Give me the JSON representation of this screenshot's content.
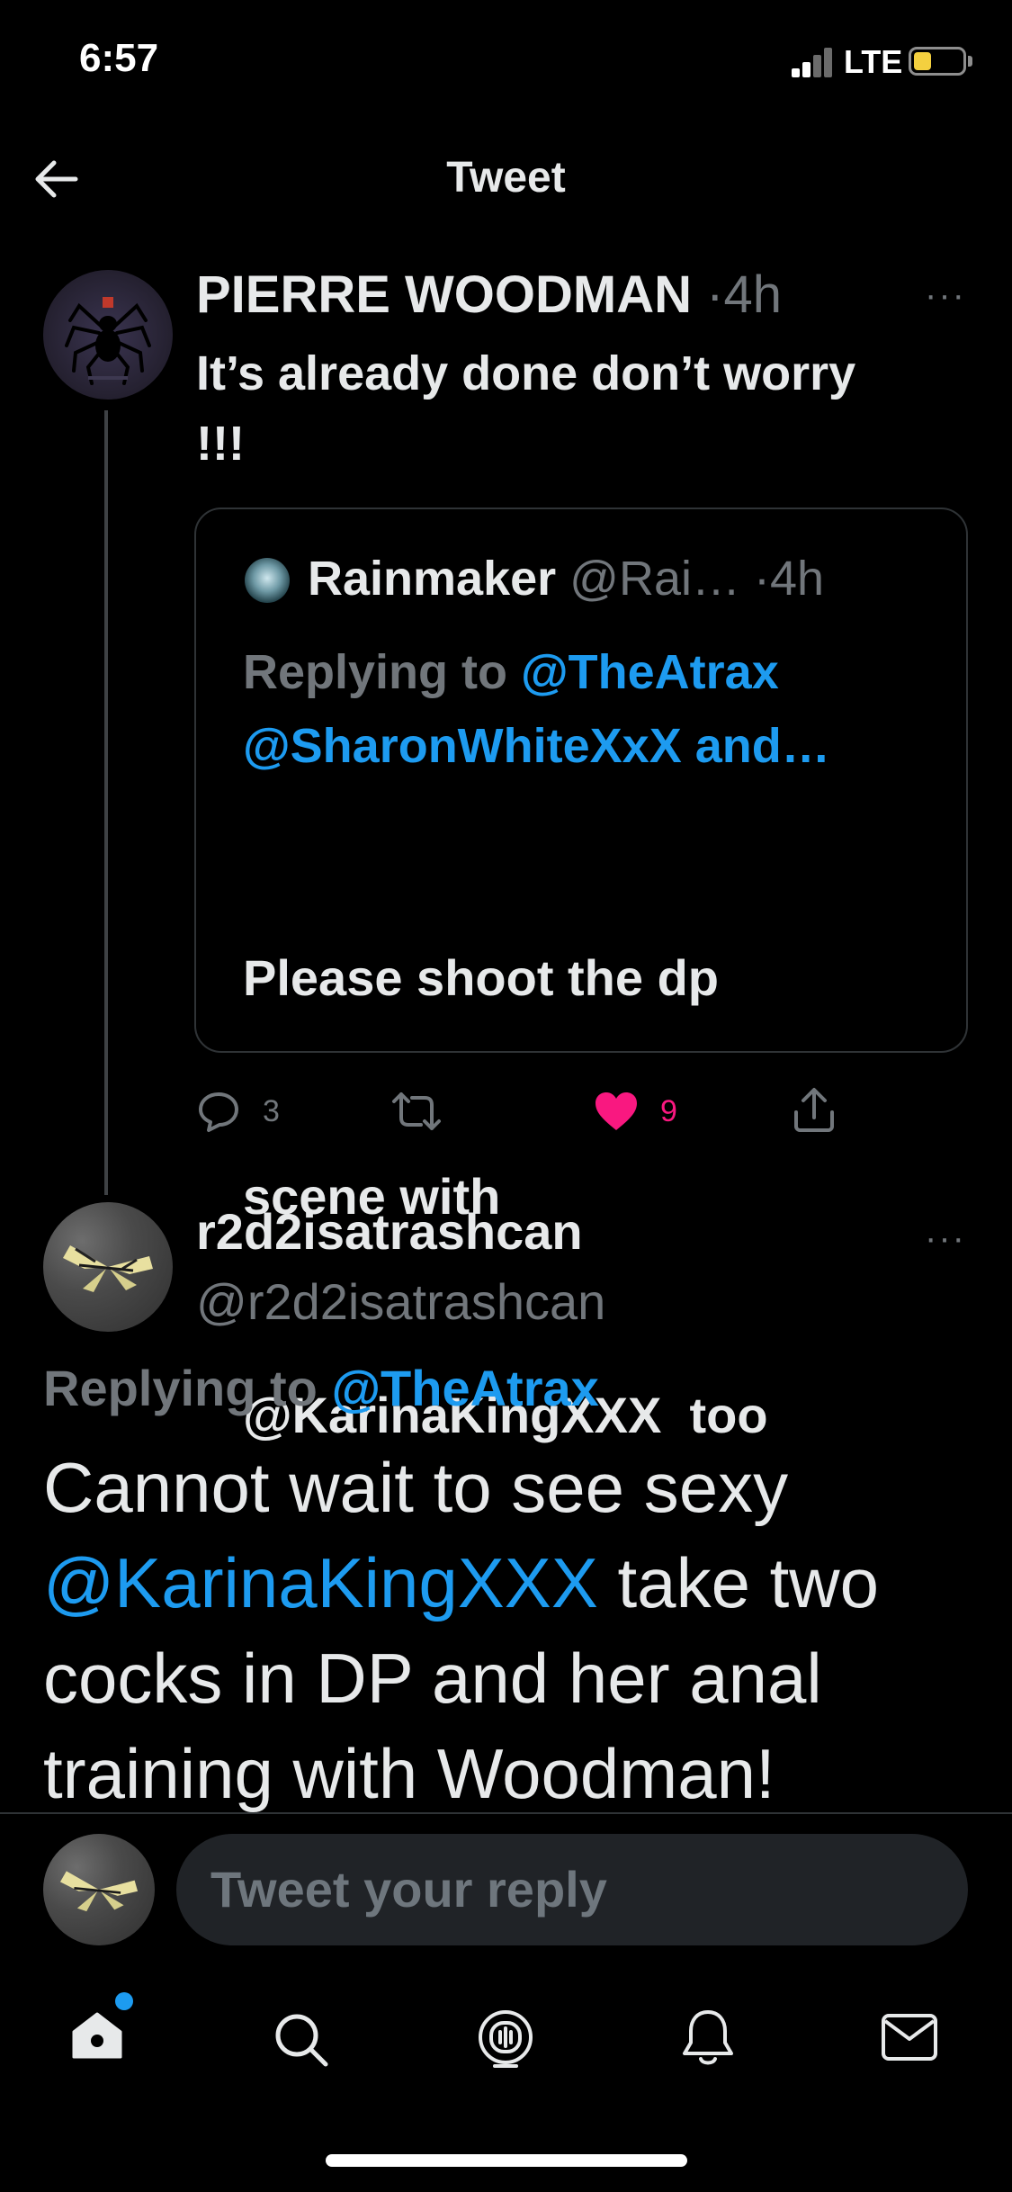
{
  "status_bar": {
    "time": "6:57",
    "network": "LTE",
    "battery_level": 0.35
  },
  "header": {
    "title": "Tweet",
    "back_icon": "arrow-left-icon"
  },
  "main_tweet": {
    "name": "PIERRE WOODMAN",
    "separator": "·",
    "time": "4h",
    "more": "···",
    "text_line1": "It’s already done don’t worry",
    "text_line2": "!!!",
    "quote": {
      "name": "Rainmaker",
      "handle": "@Rai…",
      "separator": "·",
      "time": "4h",
      "replying_label": "Replying to",
      "replying_to_1": "@TheAtrax",
      "replying_to_2": "@SharonWhiteXxX and…",
      "text_line1": "Please shoot the dp",
      "text_line2": "scene with",
      "text_line3": "@KarinaKingXXX  too"
    },
    "actions": {
      "replies": "3",
      "retweets": "",
      "likes": "9"
    }
  },
  "reply_tweet": {
    "name": "r2d2isatrashcan",
    "handle": "@r2d2isatrashcan",
    "more": "···",
    "replying_label": "Replying to",
    "replying_to": "@TheAtrax",
    "text_line1": "Cannot wait to see sexy",
    "text_mention": "@KarinaKingXXX",
    "text_line2_rest": " take two",
    "text_line3": "cocks in DP and her anal",
    "text_line4": "training with Woodman!"
  },
  "composer": {
    "placeholder": "Tweet your reply"
  },
  "colors": {
    "accent": "#1d9bf0",
    "like": "#f91880",
    "muted": "#71767b",
    "background": "#000000"
  },
  "tab_bar": [
    "home-icon",
    "search-icon",
    "spaces-icon",
    "notifications-icon",
    "messages-icon"
  ]
}
